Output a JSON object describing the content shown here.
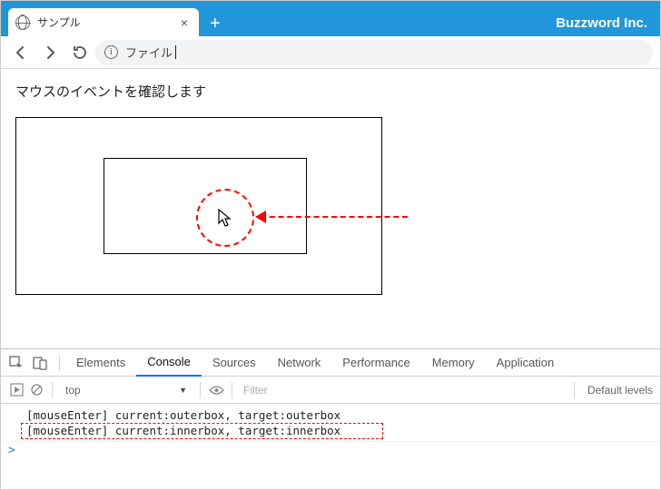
{
  "window": {
    "brand": "Buzzword Inc.",
    "tab_title": "サンプル",
    "address_label": "ファイル"
  },
  "page": {
    "heading": "マウスのイベントを確認します"
  },
  "devtools": {
    "tabs": [
      "Elements",
      "Console",
      "Sources",
      "Network",
      "Performance",
      "Memory",
      "Application"
    ],
    "active_tab": "Console",
    "context": "top",
    "filter_placeholder": "Filter",
    "levels_label": "Default levels",
    "logs": [
      "[mouseEnter] current:outerbox, target:outerbox",
      "[mouseEnter] current:innerbox, target:innerbox"
    ],
    "prompt": ">"
  }
}
